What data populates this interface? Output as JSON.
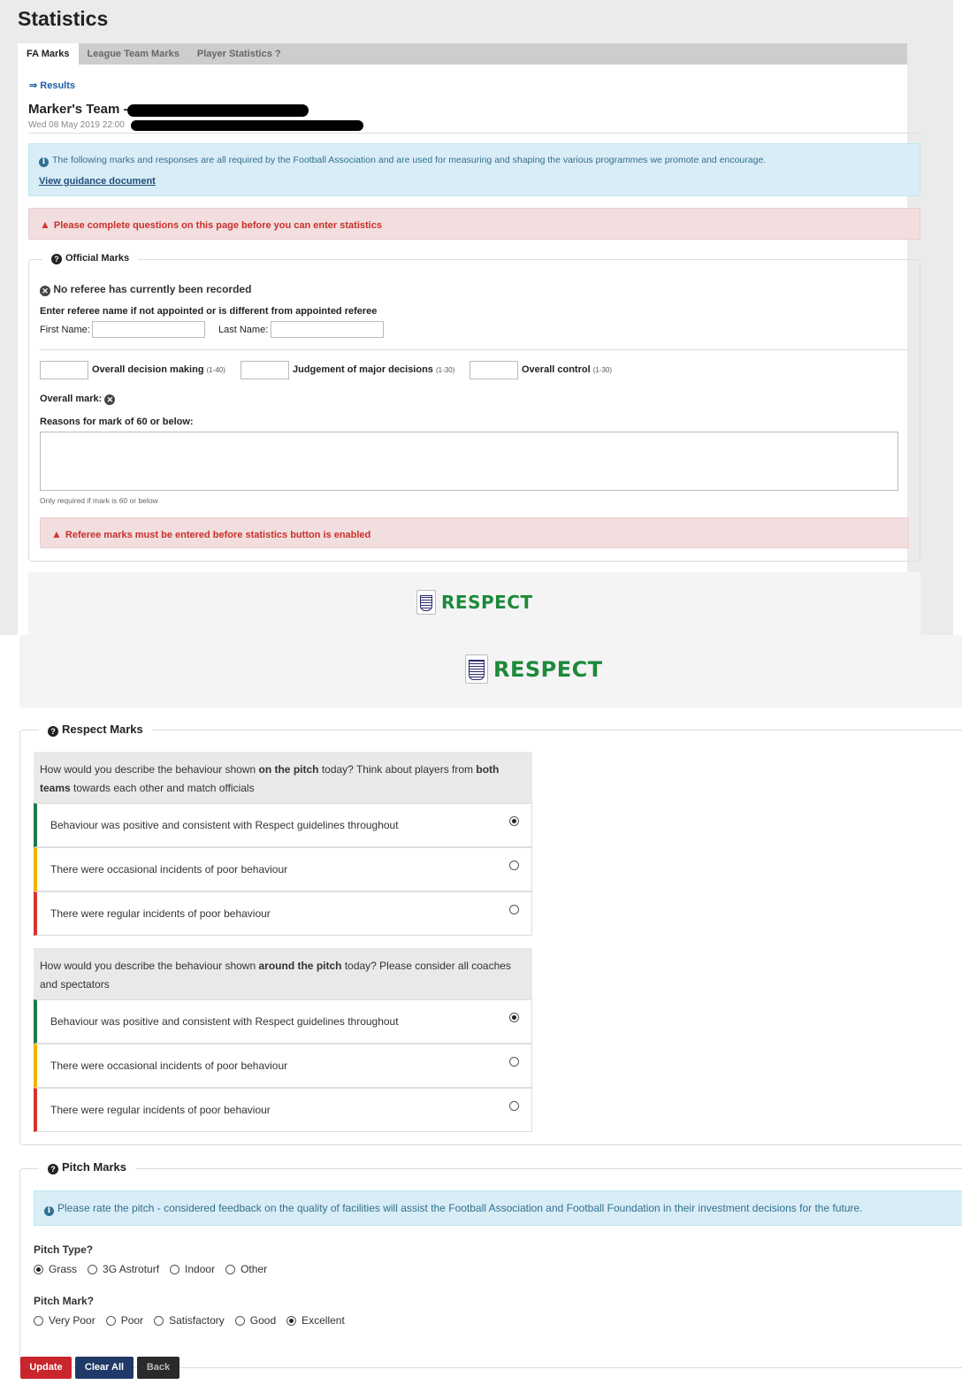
{
  "page": {
    "title": "Statistics"
  },
  "tabs": [
    {
      "label": "FA Marks"
    },
    {
      "label": "League Team Marks"
    },
    {
      "label": "Player Statistics ?"
    }
  ],
  "results_link": "⇒ Results",
  "marker": {
    "team_prefix": "Marker's Team -",
    "date": "Wed 08 May 2019 22:00"
  },
  "info": {
    "text": "The following marks and responses are all required by the Football Association and are used for measuring and shaping the various programmes we promote and encourage.",
    "guidance_link": "View guidance document"
  },
  "alert_top": "Please complete questions on this page before you can enter statistics",
  "official": {
    "legend": "Official Marks",
    "no_referee": "No referee has currently been recorded",
    "enter_prompt": "Enter referee name if not appointed or is different from appointed referee",
    "first_name_label": "First Name:",
    "first_name_value": "",
    "last_name_label": "Last Name:",
    "last_name_value": "",
    "decision_label": "Overall decision making",
    "decision_range": "(1-40)",
    "decision_value": "",
    "judgement_label": "Judgement of major decisions",
    "judgement_range": "(1-30)",
    "judgement_value": "",
    "control_label": "Overall control",
    "control_range": "(1-30)",
    "control_value": "",
    "overall_mark_label": "Overall mark:",
    "reasons_label": "Reasons for mark of 60 or below:",
    "reasons_value": "",
    "reasons_help": "Only required if mark is 60 or below",
    "alert": "Referee marks must be entered before statistics button is enabled"
  },
  "respect": {
    "banner_text": "RESPECT",
    "legend": "Respect Marks",
    "q1": {
      "pre": "How would you describe the behaviour shown ",
      "b1": "on the pitch",
      "mid": " today? Think about players from ",
      "b2": "both teams",
      "post": " towards each other and match officials"
    },
    "q2": {
      "pre": "How would you describe the behaviour shown ",
      "b1": "around the pitch",
      "post": " today? Please consider all coaches and spectators"
    },
    "options": [
      "Behaviour was positive and consistent with Respect guidelines throughout",
      "There were occasional incidents of poor behaviour",
      "There were regular incidents of poor behaviour"
    ],
    "q1_selected": 0,
    "q2_selected": 0
  },
  "pitch": {
    "legend": "Pitch Marks",
    "info": "Please rate the pitch - considered feedback on the quality of facilities will assist the Football Association and Football Foundation in their investment decisions for the future.",
    "type_label": "Pitch Type?",
    "types": [
      "Grass",
      "3G Astroturf",
      "Indoor",
      "Other"
    ],
    "type_selected": "Grass",
    "mark_label": "Pitch Mark?",
    "marks": [
      "Very Poor",
      "Poor",
      "Satisfactory",
      "Good",
      "Excellent"
    ],
    "mark_selected": "Excellent"
  },
  "buttons": {
    "update": "Update",
    "clear": "Clear All",
    "back": "Back"
  },
  "colors": {
    "update": "#c9252c",
    "clear": "#1f3a68",
    "back": "#2a2a2a",
    "respect_green": "#1c8a3a",
    "rating_green": "#1f7a4d",
    "rating_amber": "#f0b400",
    "rating_red": "#d9342f"
  }
}
